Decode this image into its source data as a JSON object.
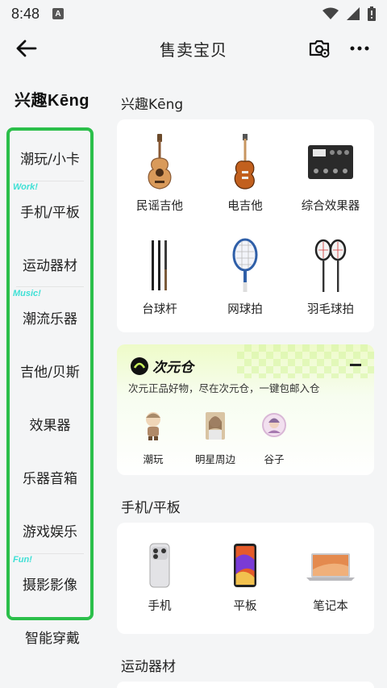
{
  "status_bar": {
    "time": "8:48",
    "badge": "A"
  },
  "app_bar": {
    "title": "售卖宝贝"
  },
  "sidebar": {
    "brand": "兴趣Kēng",
    "items": [
      {
        "label": "潮玩/小卡",
        "tag": ""
      },
      {
        "label": "手机/平板",
        "tag": "Work!"
      },
      {
        "label": "运动器材",
        "tag": ""
      },
      {
        "label": "潮流乐器",
        "tag": "Music!"
      },
      {
        "label": "吉他/贝斯",
        "tag": ""
      },
      {
        "label": "效果器",
        "tag": ""
      },
      {
        "label": "乐器音箱",
        "tag": ""
      },
      {
        "label": "游戏娱乐",
        "tag": ""
      },
      {
        "label": "摄影影像",
        "tag": "Fun!"
      },
      {
        "label": "智能穿戴",
        "tag": ""
      }
    ],
    "highlight_color": "#2bbf4a"
  },
  "main": {
    "section1": {
      "title": "兴趣Kēng",
      "products": [
        {
          "label": "民谣吉他",
          "icon": "acoustic-guitar-icon"
        },
        {
          "label": "电吉他",
          "icon": "electric-guitar-icon"
        },
        {
          "label": "综合效果器",
          "icon": "effects-pedal-icon"
        },
        {
          "label": "台球杆",
          "icon": "billiard-cue-icon"
        },
        {
          "label": "网球拍",
          "icon": "tennis-racket-icon"
        },
        {
          "label": "羽毛球拍",
          "icon": "badminton-racket-icon"
        }
      ]
    },
    "promo": {
      "brand": "次元仓",
      "subtitle": "次元正品好物，尽在次元仓，一键包邮入仓",
      "items": [
        {
          "label": "潮玩",
          "icon": "toy-figure-icon"
        },
        {
          "label": "明星周边",
          "icon": "star-photo-icon"
        },
        {
          "label": "谷子",
          "icon": "badge-icon"
        }
      ]
    },
    "section2": {
      "title": "手机/平板",
      "products": [
        {
          "label": "手机",
          "icon": "phone-icon"
        },
        {
          "label": "平板",
          "icon": "tablet-icon"
        },
        {
          "label": "笔记本",
          "icon": "laptop-icon"
        }
      ]
    },
    "section3": {
      "title": "运动器材"
    }
  }
}
